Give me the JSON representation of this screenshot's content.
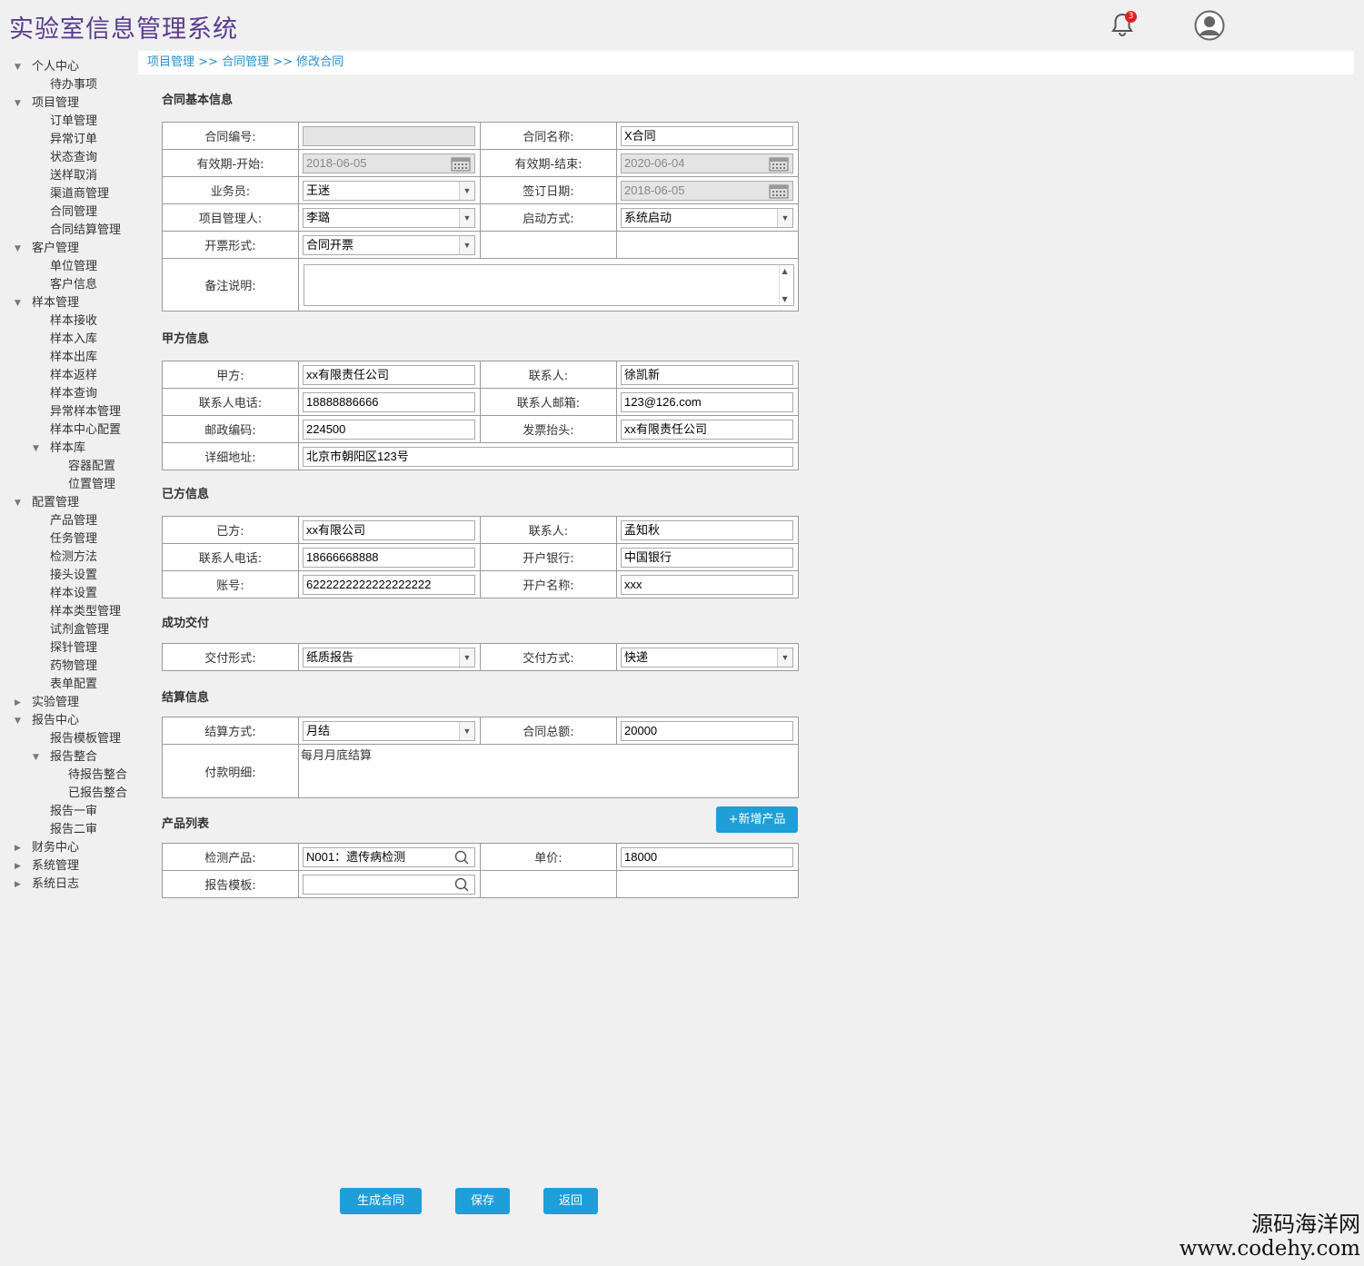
{
  "app": {
    "title": "实验室信息管理系统",
    "notification_count": "3"
  },
  "breadcrumb": {
    "level1": "项目管理",
    "sep1": " >> ",
    "level2": "合同管理",
    "sep2": "  >> ",
    "level3": "修改合同"
  },
  "sidebar": [
    {
      "label": "个人中心",
      "level": 0,
      "expander": "down"
    },
    {
      "label": "待办事项",
      "level": 1
    },
    {
      "label": "项目管理",
      "level": 0,
      "expander": "down"
    },
    {
      "label": "订单管理",
      "level": 1
    },
    {
      "label": "异常订单",
      "level": 1
    },
    {
      "label": "状态查询",
      "level": 1
    },
    {
      "label": "送样取消",
      "level": 1
    },
    {
      "label": "渠道商管理",
      "level": 1
    },
    {
      "label": "合同管理",
      "level": 1
    },
    {
      "label": "合同结算管理",
      "level": 1
    },
    {
      "label": "客户管理",
      "level": 0,
      "expander": "down"
    },
    {
      "label": "单位管理",
      "level": 1
    },
    {
      "label": "客户信息",
      "level": 1
    },
    {
      "label": "样本管理",
      "level": 0,
      "expander": "down"
    },
    {
      "label": "样本接收",
      "level": 1
    },
    {
      "label": "样本入库",
      "level": 1
    },
    {
      "label": "样本出库",
      "level": 1
    },
    {
      "label": "样本返样",
      "level": 1
    },
    {
      "label": "样本查询",
      "level": 1
    },
    {
      "label": "异常样本管理",
      "level": 1
    },
    {
      "label": "样本中心配置",
      "level": 1
    },
    {
      "label": "样本库",
      "level": 1,
      "expander": "down"
    },
    {
      "label": "容器配置",
      "level": 2
    },
    {
      "label": "位置管理",
      "level": 2
    },
    {
      "label": "配置管理",
      "level": 0,
      "expander": "down"
    },
    {
      "label": "产品管理",
      "level": 1
    },
    {
      "label": "任务管理",
      "level": 1
    },
    {
      "label": "检测方法",
      "level": 1
    },
    {
      "label": "接头设置",
      "level": 1
    },
    {
      "label": "样本设置",
      "level": 1
    },
    {
      "label": "样本类型管理",
      "level": 1
    },
    {
      "label": "试剂盒管理",
      "level": 1
    },
    {
      "label": "探针管理",
      "level": 1
    },
    {
      "label": "药物管理",
      "level": 1
    },
    {
      "label": "表单配置",
      "level": 1
    },
    {
      "label": "实验管理",
      "level": 0,
      "expander": "right"
    },
    {
      "label": "报告中心",
      "level": 0,
      "expander": "down"
    },
    {
      "label": "报告模板管理",
      "level": 1
    },
    {
      "label": "报告整合",
      "level": 1,
      "expander": "down"
    },
    {
      "label": "待报告整合",
      "level": 2
    },
    {
      "label": "已报告整合",
      "level": 2
    },
    {
      "label": "报告一审",
      "level": 1
    },
    {
      "label": "报告二审",
      "level": 1
    },
    {
      "label": "财务中心",
      "level": 0,
      "expander": "right"
    },
    {
      "label": "系统管理",
      "level": 0,
      "expander": "right"
    },
    {
      "label": "系统日志",
      "level": 0,
      "expander": "right"
    }
  ],
  "basic": {
    "title": "合同基本信息",
    "contract_no_label": "合同编号:",
    "contract_no": "",
    "contract_name_label": "合同名称:",
    "contract_name": "X合同",
    "valid_start_label": "有效期-开始:",
    "valid_start": "2018-06-05",
    "valid_end_label": "有效期-结束:",
    "valid_end": "2020-06-04",
    "salesman_label": "业务员:",
    "salesman": "王迷",
    "sign_date_label": "签订日期:",
    "sign_date": "2018-06-05",
    "pm_label": "项目管理人:",
    "pm": "李璐",
    "start_mode_label": "启动方式:",
    "start_mode": "系统启动",
    "invoice_type_label": "开票形式:",
    "invoice_type": "合同开票",
    "remark_label": "备注说明:",
    "remark": ""
  },
  "party_a": {
    "title": "甲方信息",
    "party_label": "甲方:",
    "party": "xx有限责任公司",
    "contact_label": "联系人:",
    "contact": "徐凯新",
    "phone_label": "联系人电话:",
    "phone": "18888886666",
    "email_label": "联系人邮箱:",
    "email": "123@126.com",
    "zip_label": "邮政编码:",
    "zip": "224500",
    "invoice_title_label": "发票抬头:",
    "invoice_title": "xx有限责任公司",
    "address_label": "详细地址:",
    "address": "北京市朝阳区123号"
  },
  "party_b": {
    "title": "已方信息",
    "party_label": "已方:",
    "party": "xx有限公司",
    "contact_label": "联系人:",
    "contact": "孟知秋",
    "phone_label": "联系人电话:",
    "phone": "18666668888",
    "bank_label": "开户银行:",
    "bank": "中国银行",
    "account_label": "账号:",
    "account": "6222222222222222222",
    "account_name_label": "开户名称:",
    "account_name": "xxx"
  },
  "delivery": {
    "title": "成功交付",
    "form_label": "交付形式:",
    "form": "纸质报告",
    "method_label": "交付方式:",
    "method": "快递"
  },
  "settlement": {
    "title": "结算信息",
    "mode_label": "结算方式:",
    "mode": "月结",
    "total_label": "合同总额:",
    "total": "20000",
    "detail_label": "付款明细:",
    "detail": "每月月底结算"
  },
  "products": {
    "title": "产品列表",
    "add_button": "+新增产品",
    "product_label": "检测产品:",
    "product": "N001：遗传病检测",
    "price_label": "单价:",
    "price": "18000",
    "template_label": "报告模板:",
    "template": ""
  },
  "actions": {
    "generate": "生成合同",
    "save": "保存",
    "back": "返回"
  },
  "watermark": {
    "line1": "源码海洋网",
    "line2": "www.codehy.com"
  },
  "colors": {
    "title": "#5a3a8e",
    "accent": "#1e9fd8",
    "link": "#2a8fc9"
  }
}
